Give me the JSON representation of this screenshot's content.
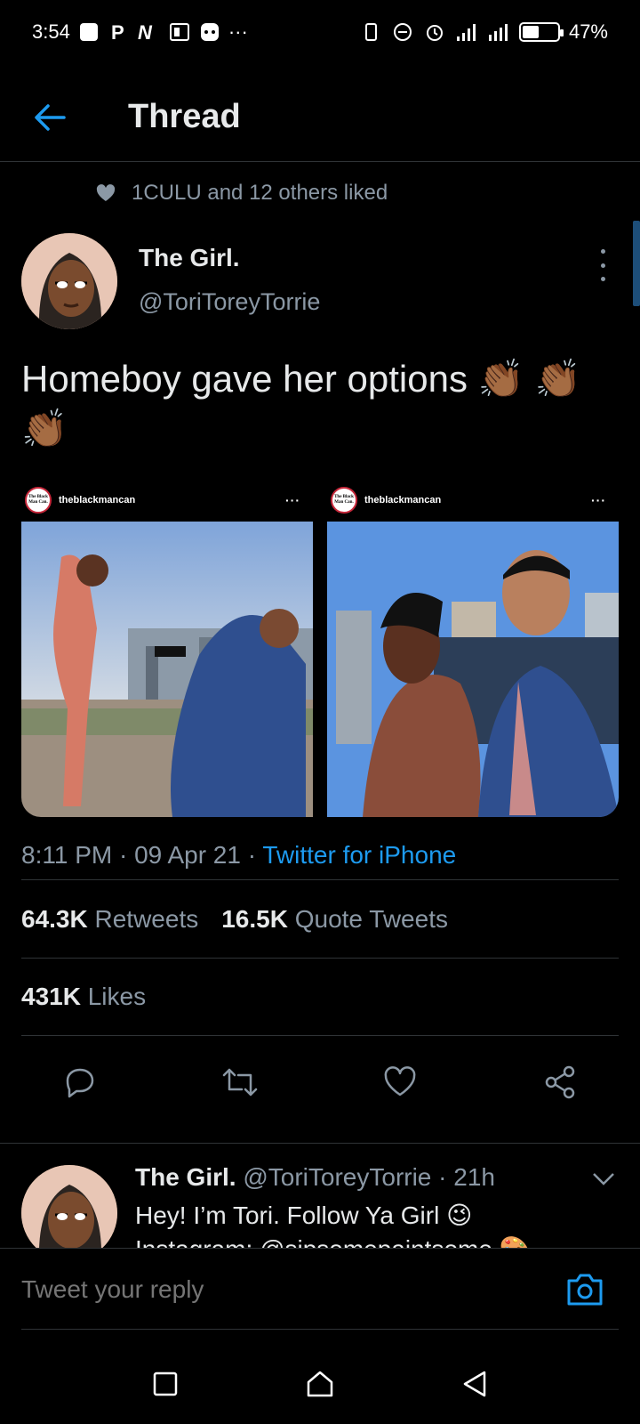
{
  "status_bar": {
    "time": "3:54",
    "battery": "47%",
    "battery_level": 0.47,
    "overflow": "···"
  },
  "header": {
    "title": "Thread"
  },
  "social_context": {
    "text": "1CULU and 12 others liked"
  },
  "tweet": {
    "author_name": "The Girl.",
    "author_handle": "@ToriToreyTorrie",
    "text": "Homeboy gave her options 👏🏾 👏🏾 👏🏾",
    "timestamp": "8:11 PM · 09 Apr 21 · ",
    "source": "Twitter for iPhone",
    "media": [
      {
        "account": "theblackmancan",
        "logo_text": "The Black Man Can."
      },
      {
        "account": "theblackmancan",
        "logo_text": "The Black Man Can."
      }
    ]
  },
  "stats": {
    "retweets_count": "64.3K",
    "retweets_label": "Retweets",
    "quotes_count": "16.5K",
    "quotes_label": "Quote Tweets",
    "likes_count": "431K",
    "likes_label": "Likes"
  },
  "reply": {
    "author_name": "The Girl.",
    "meta": "@ToriToreyTorrie · 21h",
    "line1": "Hey! I’m Tori. Follow Ya Girl 😉",
    "line2": "Instagram: @sipsomepaintsome 🎨"
  },
  "compose": {
    "placeholder": "Tweet your reply"
  },
  "colors": {
    "background": "#000000",
    "accent": "#1d9bf0",
    "secondary_text": "#8b98a5",
    "divider": "#2f3336"
  },
  "icons": [
    "back-arrow-icon",
    "heart-icon",
    "more-icon",
    "reply-icon",
    "retweet-icon",
    "like-icon",
    "share-icon",
    "chevron-down-icon",
    "camera-icon",
    "recent-apps-icon",
    "home-icon",
    "back-nav-icon"
  ]
}
